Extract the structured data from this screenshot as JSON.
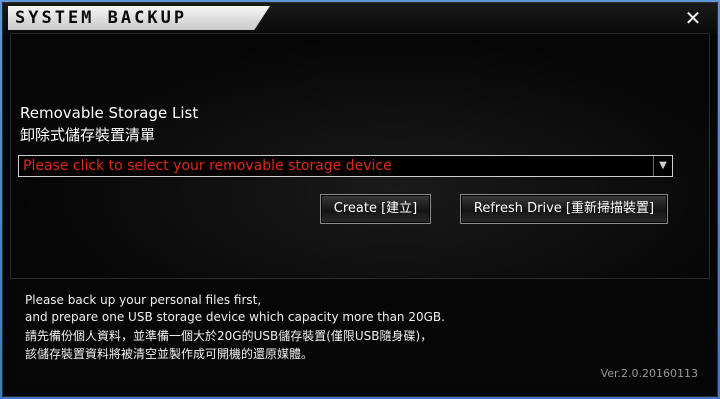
{
  "window": {
    "title": "SYSTEM BACKUP",
    "close_glyph": "✕"
  },
  "storage": {
    "heading_en": "Removable Storage List",
    "heading_zh": "卸除式儲存裝置清單",
    "select_placeholder": "Please click to select your removable storage device"
  },
  "buttons": {
    "create": "Create [建立]",
    "refresh": "Refresh Drive [重新掃描裝置]"
  },
  "info": {
    "line1": "Please back up your personal files first,",
    "line2": "and prepare one USB storage device which capacity more than 20GB.",
    "line3": "請先備份個人資料，並準備一個大於20G的USB儲存裝置(僅限USB隨身碟)，",
    "line4": "該儲存裝置資料將被清空並製作成可開機的還原媒體。"
  },
  "version": "Ver.2.0.20160113",
  "icons": {
    "close": "close-icon",
    "dropdown": "chevron-down-icon"
  },
  "colors": {
    "placeholder_text": "#e02a14",
    "window_bg": "#050505",
    "title_plate": "#e6e6e6"
  }
}
